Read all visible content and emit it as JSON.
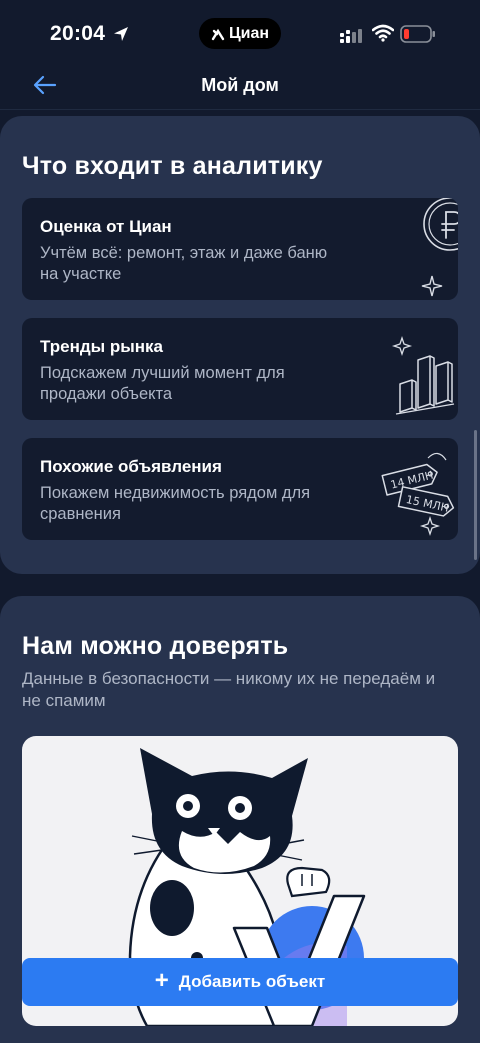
{
  "status_bar": {
    "time": "20:04",
    "carrier_pill": "Циан",
    "icons": [
      "location-arrow-icon",
      "cellular-signal-icon",
      "wifi-icon",
      "battery-low-icon"
    ]
  },
  "nav": {
    "back_icon": "arrow-left-icon",
    "title": "Мой дом"
  },
  "analytics": {
    "title": "Что входит в аналитику",
    "items": [
      {
        "title": "Оценка от Циан",
        "description": "Учтём всё: ремонт, этаж и даже баню на участке",
        "icon": "ruble-coin-icon"
      },
      {
        "title": "Тренды рынка",
        "description": "Подскажем лучший момент для продажи объекта",
        "icon": "bar-chart-icon"
      },
      {
        "title": "Похожие объявления",
        "description": "Покажем недвижимость рядом для сравнения",
        "icon": "price-tags-icon",
        "tag_1": "14 МЛН",
        "tag_2": "15 МЛН"
      }
    ]
  },
  "trust": {
    "title": "Нам можно доверять",
    "subtitle": "Данные в безопасности — никому их не передаём и не спамим",
    "illustration": "cat-with-checkmark-illustration"
  },
  "add_button": {
    "icon": "plus-icon",
    "label": "Добавить объект"
  },
  "colors": {
    "background": "#121a2d",
    "card": "#27334e",
    "feature_card": "#131b2e",
    "accent": "#2c7bf2",
    "muted_text": "#aeb6c6",
    "battery_low": "#ff3b30"
  }
}
